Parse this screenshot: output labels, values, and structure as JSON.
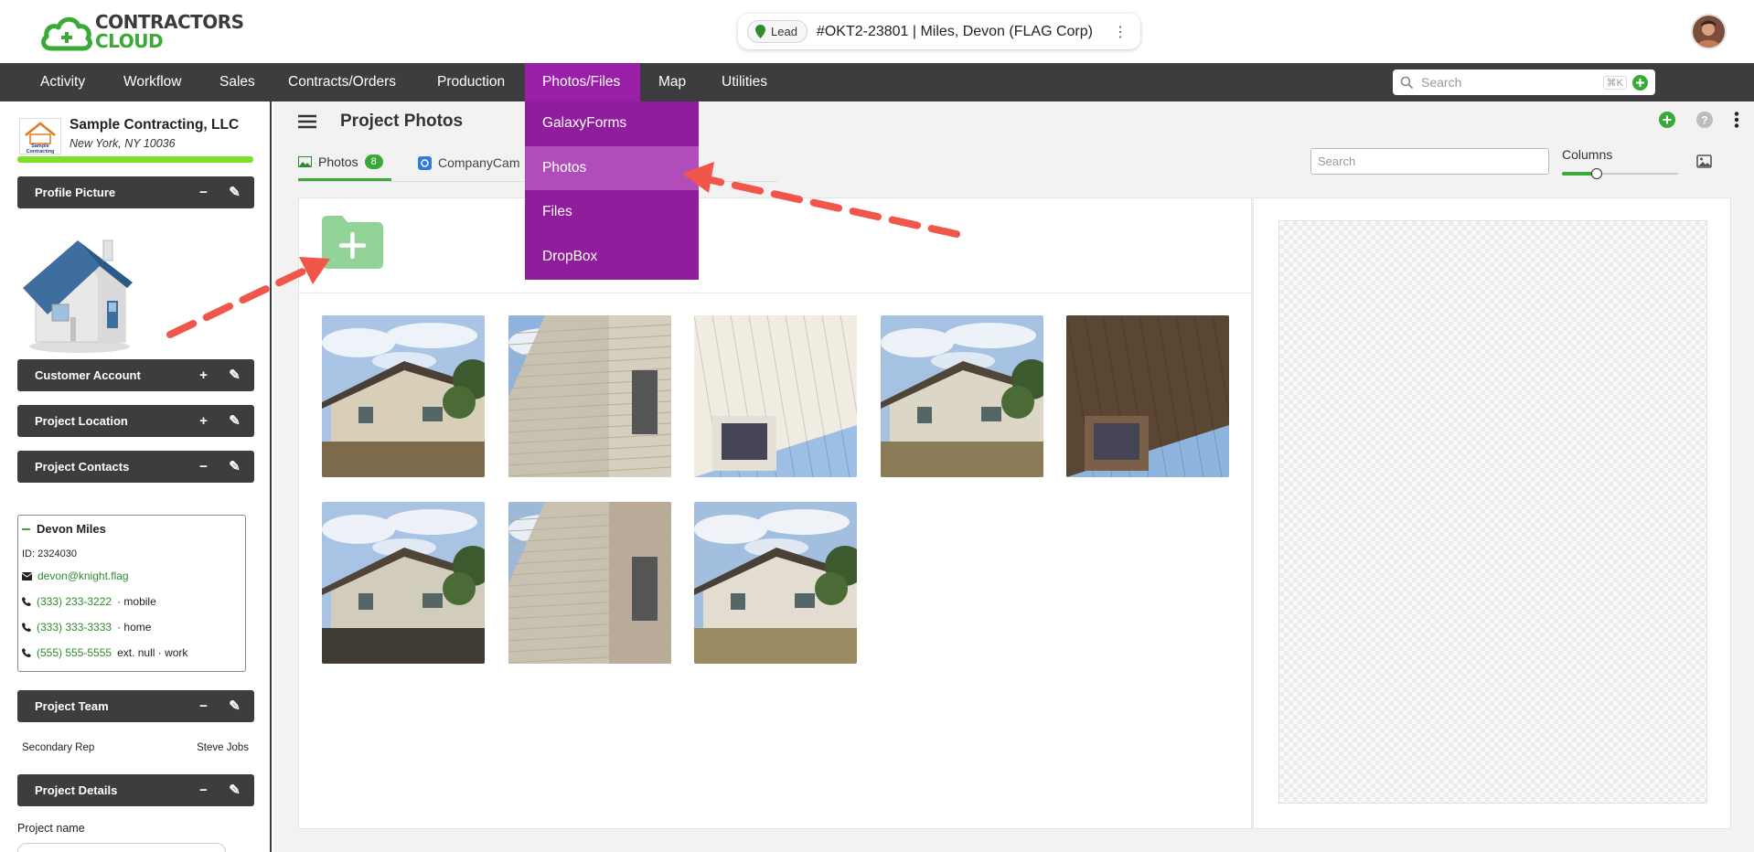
{
  "brand": {
    "line1": "CONTRACTORS",
    "line2": "CLOUD",
    "color": "#3aa935"
  },
  "record": {
    "status": "Lead",
    "title": "#OKT2-23801 | Miles, Devon (FLAG Corp)",
    "menu_icon": "vertical-dots-icon"
  },
  "nav": {
    "items": [
      "Activity",
      "Workflow",
      "Sales",
      "Contracts/Orders",
      "Production",
      "Photos/Files",
      "Map",
      "Utilities"
    ],
    "active": "Photos/Files",
    "active_color": "#9a1fa8",
    "search_placeholder": "Search",
    "shortcut": "⌘K"
  },
  "dropdown": {
    "items": [
      "GalaxyForms",
      "Photos",
      "Files",
      "DropBox"
    ],
    "highlighted": "Photos"
  },
  "sidebar": {
    "company_logo_text": "Sample Contracting",
    "company_name": "Sample Contracting, LLC",
    "company_address": "New York, NY 10036",
    "panels": {
      "profile_picture": "Profile Picture",
      "customer_account": "Customer Account",
      "project_location": "Project Location",
      "project_contacts": "Project Contacts",
      "project_team": "Project Team",
      "project_details": "Project Details"
    },
    "contact": {
      "name": "Devon Miles",
      "id": "ID: 2324030",
      "email": "devon@knight.flag",
      "phones": [
        {
          "number": "(333) 233-3222",
          "type": "· mobile"
        },
        {
          "number": "(333) 333-3333",
          "type": "· home"
        },
        {
          "number": "(555) 555-5555",
          "type": "ext. null · work"
        }
      ]
    },
    "team": {
      "role": "Secondary Rep",
      "person": "Steve Jobs"
    },
    "details": {
      "project_name_label": "Project name"
    }
  },
  "main": {
    "title": "Project Photos",
    "tabs": {
      "photos": "Photos",
      "photos_count": "8",
      "companycam": "CompanyCam"
    },
    "search_placeholder": "Search",
    "columns_label": "Columns",
    "columns_level": 0.3,
    "photo_count": 8
  },
  "annotations": {
    "arrow_color": "#f0564a",
    "count": 2
  }
}
